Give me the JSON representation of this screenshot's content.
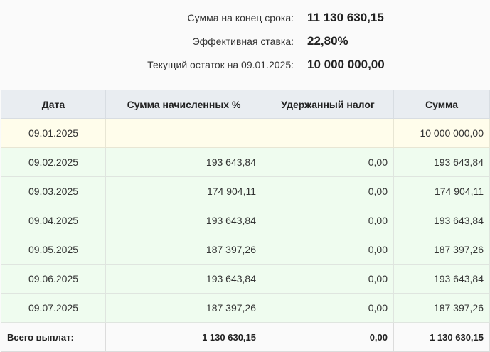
{
  "summary": {
    "total_label": "Сумма на конец срока:",
    "total_value": "11 130 630,15",
    "rate_label": "Эффективная ставка:",
    "rate_value": "22,80%",
    "balance_label": "Текущий остаток на 09.01.2025:",
    "balance_value": "10 000 000,00"
  },
  "table": {
    "headers": [
      "Дата",
      "Сумма начисленных %",
      "Удержанный налог",
      "Сумма"
    ],
    "rows": [
      {
        "date": "09.01.2025",
        "interest": "",
        "tax": "",
        "amount": "10 000 000,00"
      },
      {
        "date": "09.02.2025",
        "interest": "193 643,84",
        "tax": "0,00",
        "amount": "193 643,84"
      },
      {
        "date": "09.03.2025",
        "interest": "174 904,11",
        "tax": "0,00",
        "amount": "174 904,11"
      },
      {
        "date": "09.04.2025",
        "interest": "193 643,84",
        "tax": "0,00",
        "amount": "193 643,84"
      },
      {
        "date": "09.05.2025",
        "interest": "187 397,26",
        "tax": "0,00",
        "amount": "187 397,26"
      },
      {
        "date": "09.06.2025",
        "interest": "193 643,84",
        "tax": "0,00",
        "amount": "193 643,84"
      },
      {
        "date": "09.07.2025",
        "interest": "187 397,26",
        "tax": "0,00",
        "amount": "187 397,26"
      }
    ],
    "total": {
      "label": "Всего выплат:",
      "interest": "1 130 630,15",
      "tax": "0,00",
      "amount": "1 130 630,15"
    }
  }
}
